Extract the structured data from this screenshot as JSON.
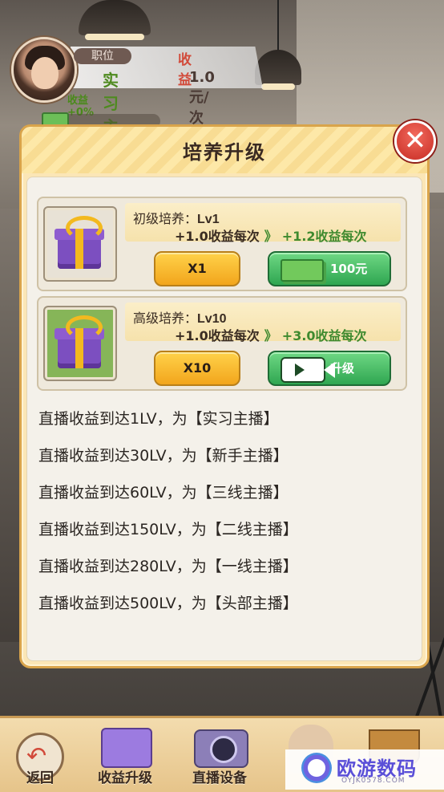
{
  "hud": {
    "position_label": "职位",
    "income_label": "收益",
    "position_name": "实习主播",
    "income_rate": "1.0元/次",
    "bonus": "收益+0%"
  },
  "panel": {
    "title": "培养升级",
    "close_label": "✕",
    "cards": [
      {
        "name": "初级培养：",
        "level": "Lv1",
        "current": "+1.0收益每次",
        "arrow": "》",
        "next": "+1.2收益每次",
        "multi_button": "X1",
        "action_button": "100元",
        "action_icon": "cash-icon",
        "gift_icon": "gift-icon"
      },
      {
        "name": "高级培养：",
        "level": "Lv10",
        "current": "+1.0收益每次",
        "arrow": "》",
        "next": "+3.0收益每次",
        "multi_button": "X10",
        "action_button": "升级",
        "action_icon": "video-icon",
        "gift_icon": "gift-icon"
      }
    ],
    "levels": [
      "直播收益到达1LV，为【实习主播】",
      "直播收益到达30LV，为【新手主播】",
      "直播收益到达60LV，为【三线主播】",
      "直播收益到达150LV，为【二线主播】",
      "直播收益到达280LV，为【一线主播】",
      "直播收益到达500LV，为【头部主播】"
    ]
  },
  "bottom_tabs": [
    {
      "label": "返回",
      "icon": "back-arrow-icon"
    },
    {
      "label": "收益升级",
      "icon": "gift-upgrade-icon"
    },
    {
      "label": "直播设备",
      "icon": "camera-icon"
    },
    {
      "label": "",
      "icon": "character-icon"
    },
    {
      "label": "",
      "icon": "basket-icon"
    }
  ],
  "watermark": {
    "text": "欧游数码",
    "sub": "OYJK0578.COM"
  },
  "colors": {
    "panel_bg": "#fbe6b6",
    "yellow_button": "#f2a51c",
    "green_button": "#2fa651",
    "close_red": "#c72c24",
    "effect_green": "#3f8a2f"
  }
}
